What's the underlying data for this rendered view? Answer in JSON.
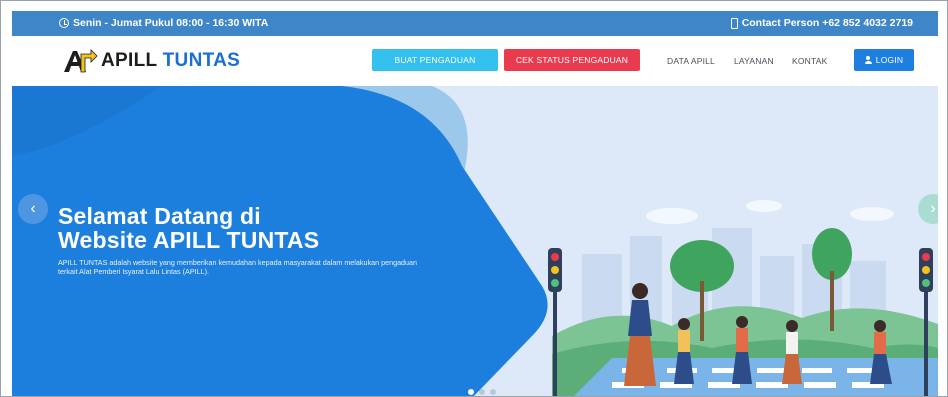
{
  "topbar": {
    "hours": "Senin - Jumat Pukul 08:00 - 16:30 WITA",
    "contact": "Contact Person +62 852 4032 2719"
  },
  "logo": {
    "part_a": "APILL",
    "part_b": "TUNTAS"
  },
  "nav": {
    "buat_pengaduan": "BUAT PENGADUAN",
    "cek_status": "CEK STATUS PENGADUAN",
    "data_apill": "DATA APILL",
    "layanan": "LAYANAN",
    "kontak": "KONTAK",
    "login": "LOGIN"
  },
  "hero": {
    "title_line1": "Selamat Datang di",
    "title_line2": "Website APILL TUNTAS",
    "description": "APILL TUNTAS adalah website yang memberikan kemudahan kepada masyarakat dalam melakukan pengaduan terkait Alat Pemberi Isyarat Lalu Lintas (APILL).",
    "prev_icon": "chevron-left-icon",
    "next_icon": "chevron-right-icon",
    "slides": 3,
    "active_slide": 1
  },
  "colors": {
    "topbar": "#3f86c8",
    "hero_blue": "#1d7fdd",
    "buat_button": "#34c0ee",
    "cek_button": "#ea3a4d",
    "login_button": "#1e7fe0"
  }
}
